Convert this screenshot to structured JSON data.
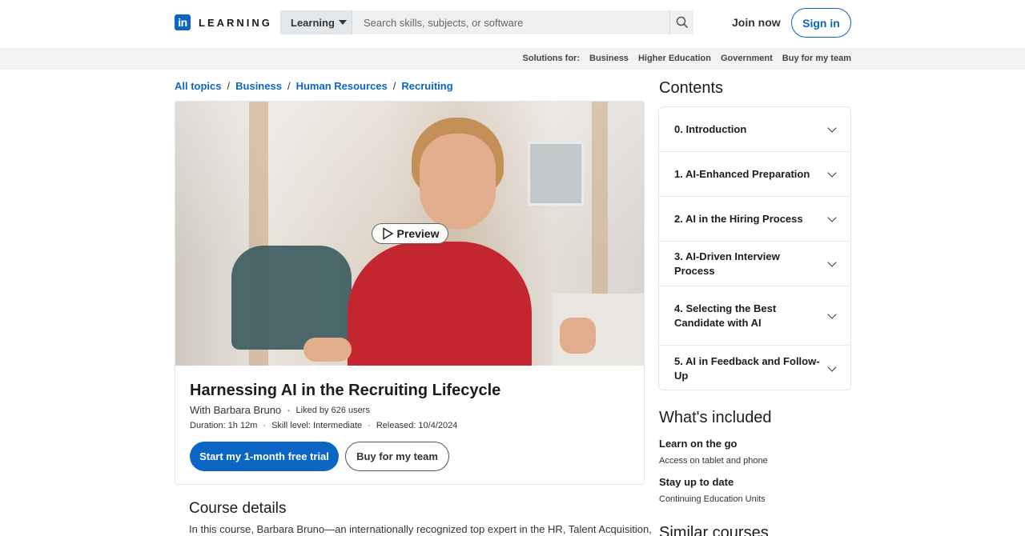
{
  "header": {
    "logo_letters": "in",
    "logo_text": "LEARNING",
    "search_dropdown": "Learning",
    "search_placeholder": "Search skills, subjects, or software",
    "join_label": "Join now",
    "signin_label": "Sign in"
  },
  "subbar": {
    "label": "Solutions for:",
    "links": [
      "Business",
      "Higher Education",
      "Government",
      "Buy for my team"
    ]
  },
  "breadcrumb": [
    "All topics",
    "Business",
    "Human Resources",
    "Recruiting"
  ],
  "course": {
    "preview_label": "Preview",
    "title": "Harnessing AI in the Recruiting Lifecycle",
    "author": "With Barbara Bruno",
    "liked": "Liked by 626 users",
    "duration": "Duration: 1h 12m",
    "skill": "Skill level: Intermediate",
    "released": "Released: 10/4/2024",
    "primary_cta": "Start my 1-month free trial",
    "secondary_cta": "Buy for my team"
  },
  "details": {
    "heading": "Course details",
    "text": "In this course, Barbara Bruno—an internationally recognized top expert in the HR, Talent Acquisition,"
  },
  "contents": {
    "heading": "Contents",
    "items": [
      "0. Introduction",
      "1. AI-Enhanced Preparation",
      "2. AI in the Hiring Process",
      "3. AI-Driven Interview Process",
      "4. Selecting the Best Candidate with AI",
      "5. AI in Feedback and Follow-Up"
    ]
  },
  "included": {
    "heading": "What's included",
    "item1_title": "Learn on the go",
    "item1_desc": "Access on tablet and phone",
    "item2_title": "Stay up to date",
    "item2_desc": "Continuing Education Units"
  },
  "similar": {
    "heading": "Similar courses"
  },
  "colors": {
    "accent": "#0a66c2",
    "jacket": "#c3262e"
  }
}
